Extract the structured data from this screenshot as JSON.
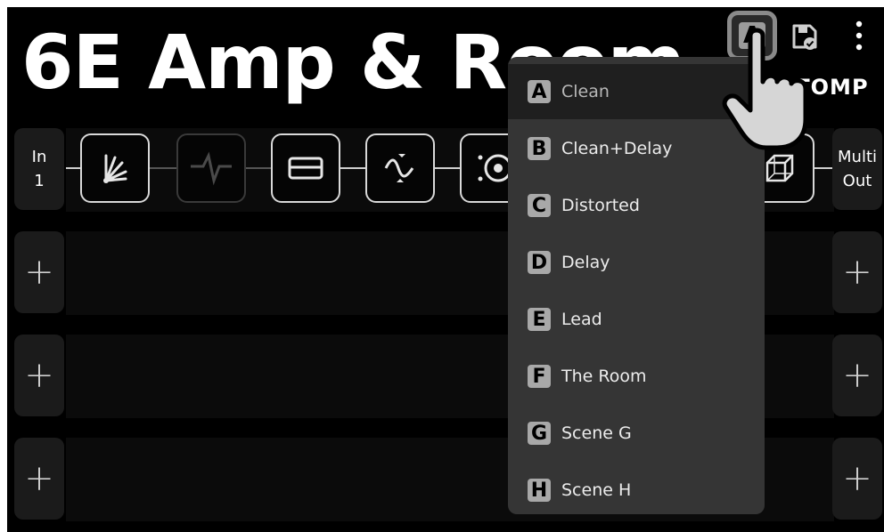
{
  "preset": {
    "title": "6E Amp & Room"
  },
  "header": {
    "scene_button_letter": "A",
    "mode_label": "STOMP"
  },
  "io": {
    "input": {
      "line1": "In",
      "line2": "1"
    },
    "output": {
      "line1": "Multi",
      "line2": "Out"
    }
  },
  "add_slot_label": "+",
  "signal_chain": [
    {
      "icon": "compressor-fan-icon",
      "active": true
    },
    {
      "icon": "gate-wave-icon",
      "active": false
    },
    {
      "icon": "amp-rect-icon",
      "active": true
    },
    {
      "icon": "modulation-wave-icon",
      "active": true
    },
    {
      "icon": "speaker-circle-icon",
      "active": true
    },
    {
      "icon": "cube-room-icon",
      "active": true
    }
  ],
  "scene_menu": {
    "items": [
      {
        "letter": "A",
        "label": "Clean",
        "selected": true
      },
      {
        "letter": "B",
        "label": "Clean+Delay"
      },
      {
        "letter": "C",
        "label": "Distorted"
      },
      {
        "letter": "D",
        "label": "Delay"
      },
      {
        "letter": "E",
        "label": "Lead"
      },
      {
        "letter": "F",
        "label": "The Room"
      },
      {
        "letter": "G",
        "label": "Scene G"
      },
      {
        "letter": "H",
        "label": "Scene H"
      }
    ]
  },
  "colors": {
    "background": "#000000",
    "menu": "#353535",
    "badge": "#a8a8a8",
    "text": "#ffffff"
  }
}
